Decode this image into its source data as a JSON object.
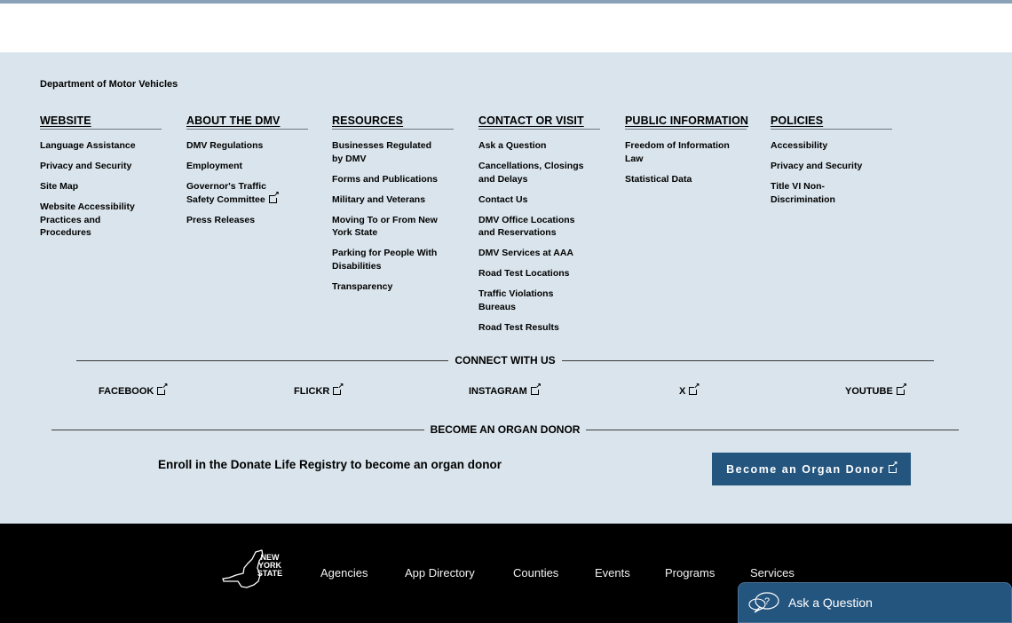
{
  "footer": {
    "department_title": "Department of Motor Vehicles",
    "columns": [
      {
        "heading": "WEBSITE",
        "links": [
          {
            "label": "Language Assistance",
            "external": false
          },
          {
            "label": "Privacy and Security",
            "external": false
          },
          {
            "label": "Site Map",
            "external": false
          },
          {
            "label": "Website Accessibility Practices and Procedures",
            "external": false
          }
        ]
      },
      {
        "heading": "ABOUT THE DMV",
        "links": [
          {
            "label": "DMV Regulations",
            "external": false
          },
          {
            "label": "Employment",
            "external": false
          },
          {
            "label": "Governor's Traffic Safety Committee",
            "external": true
          },
          {
            "label": "Press Releases",
            "external": false
          }
        ]
      },
      {
        "heading": "RESOURCES",
        "links": [
          {
            "label": "Businesses Regulated by DMV",
            "external": false
          },
          {
            "label": "Forms and Publications",
            "external": false
          },
          {
            "label": "Military and Veterans",
            "external": false
          },
          {
            "label": "Moving To or From New York State",
            "external": false
          },
          {
            "label": "Parking for People With Disabilities",
            "external": false
          },
          {
            "label": "Transparency",
            "external": false
          }
        ]
      },
      {
        "heading": "CONTACT OR VISIT",
        "links": [
          {
            "label": "Ask a Question",
            "external": false
          },
          {
            "label": "Cancellations, Closings and Delays",
            "external": false
          },
          {
            "label": "Contact Us",
            "external": false
          },
          {
            "label": "DMV Office Locations and Reservations",
            "external": false
          },
          {
            "label": "DMV Services at AAA",
            "external": false
          },
          {
            "label": "Road Test Locations",
            "external": false
          },
          {
            "label": "Traffic Violations Bureaus",
            "external": false
          },
          {
            "label": "Road Test Results",
            "external": false
          }
        ]
      },
      {
        "heading": "PUBLIC INFORMATION",
        "links": [
          {
            "label": "Freedom of Information Law",
            "external": false
          },
          {
            "label": "Statistical Data",
            "external": false
          }
        ]
      },
      {
        "heading": "POLICIES",
        "links": [
          {
            "label": "Accessibility",
            "external": false
          },
          {
            "label": "Privacy and Security",
            "external": false
          },
          {
            "label": "Title VI Non-Discrimination",
            "external": false
          }
        ]
      }
    ],
    "connect": {
      "heading": "CONNECT WITH US",
      "social": [
        {
          "label": "FACEBOOK",
          "icon": "external-link-icon"
        },
        {
          "label": "FLICKR",
          "icon": "external-link-icon"
        },
        {
          "label": "INSTAGRAM",
          "icon": "external-link-icon"
        },
        {
          "label": "X",
          "icon": "external-link-icon"
        },
        {
          "label": "YOUTUBE",
          "icon": "external-link-icon"
        }
      ]
    },
    "organ_donor": {
      "heading": "BECOME AN ORGAN DONOR",
      "text": "Enroll in the Donate Life Registry to become an organ donor",
      "button_label": "Become an Organ Donor"
    }
  },
  "bottom_bar": {
    "logo_text": [
      "NEW",
      "YORK",
      "STATE"
    ],
    "nav": [
      "Agencies",
      "App Directory",
      "Counties",
      "Events",
      "Programs",
      "Services"
    ]
  },
  "ask_widget": {
    "label": "Ask a Question",
    "icon": "chat-question-icon"
  },
  "colors": {
    "footer_bg": "#d9e4ec",
    "accent_blue": "#24557f",
    "bottom_bar_bg": "#000000"
  }
}
